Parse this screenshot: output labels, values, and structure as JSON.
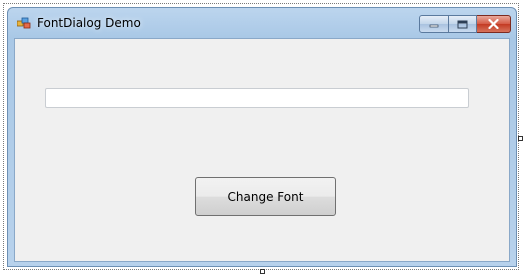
{
  "window": {
    "title": "FontDialog Demo",
    "icon": "app-window-icon",
    "caption_buttons": [
      "minimize-icon",
      "maximize-icon",
      "close-icon"
    ]
  },
  "form": {
    "textbox_value": "",
    "change_font_label": "Change Font"
  },
  "colors": {
    "titlebar": "#a9c8e6",
    "client_background": "#f0f0f0",
    "close_button": "#c33a23"
  }
}
